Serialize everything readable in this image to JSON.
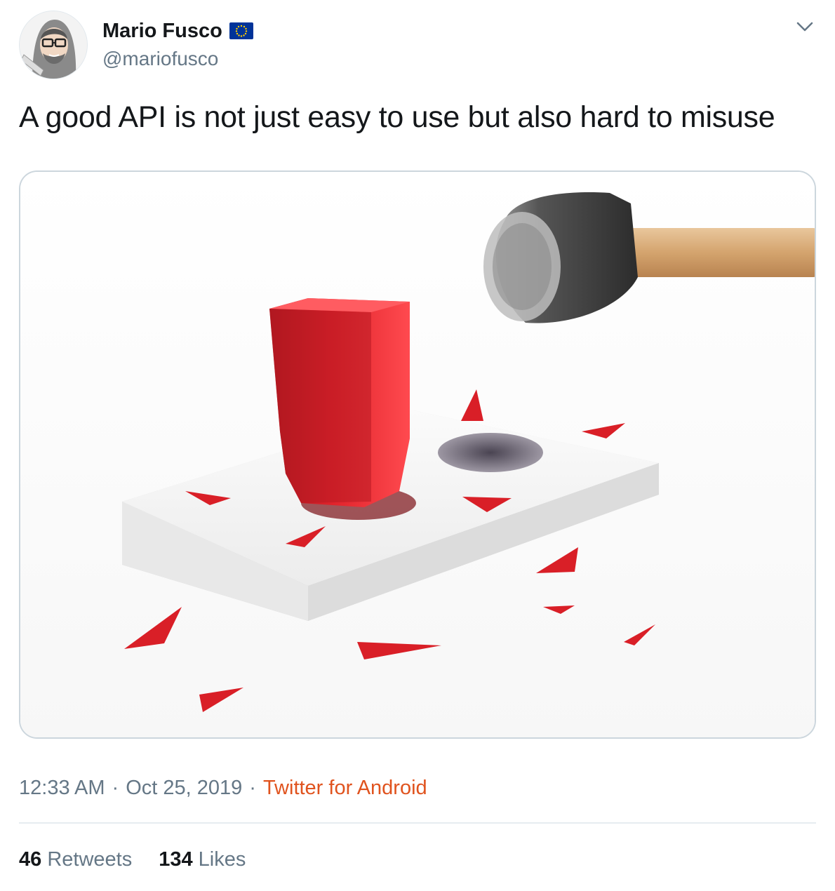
{
  "user": {
    "name": "Mario Fusco",
    "handle": "@mariofusco",
    "avatar_icon": "cartoon-avatar-icon",
    "badge_icon": "eu-flag-icon"
  },
  "tweet": {
    "text": "A good API is not just easy to use but also hard to misuse",
    "media_icon": "photo-hammer-red-peg-icon"
  },
  "meta": {
    "time": "12:33 AM",
    "separator": "·",
    "date": "Oct 25, 2019",
    "source": "Twitter for Android"
  },
  "stats": {
    "retweets_count": "46",
    "retweets_label": "Retweets",
    "likes_count": "134",
    "likes_label": "Likes"
  },
  "colors": {
    "text": "#14171a",
    "secondary": "#657786",
    "source_link": "#e0531e",
    "border": "#ccd6dd",
    "eu_blue": "#003399",
    "eu_star": "#ffcc00"
  }
}
